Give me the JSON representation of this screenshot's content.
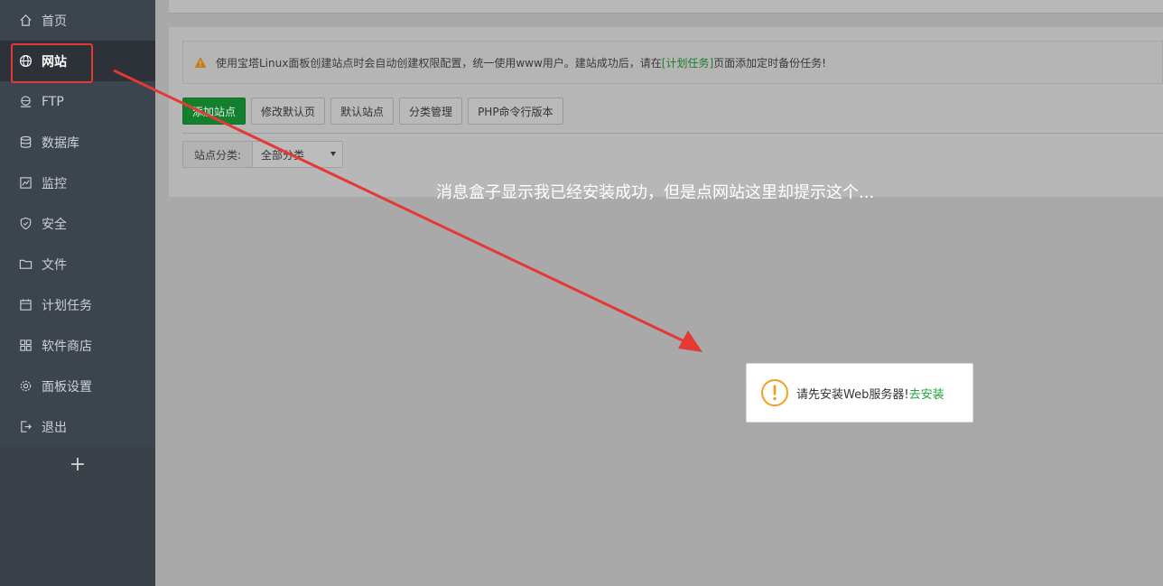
{
  "sidebar": {
    "items": [
      {
        "label": "首页",
        "icon": "home-icon"
      },
      {
        "label": "网站",
        "icon": "globe-icon",
        "active": true
      },
      {
        "label": "FTP",
        "icon": "ftp-icon"
      },
      {
        "label": "数据库",
        "icon": "database-icon"
      },
      {
        "label": "监控",
        "icon": "monitor-icon"
      },
      {
        "label": "安全",
        "icon": "shield-icon"
      },
      {
        "label": "文件",
        "icon": "folder-icon"
      },
      {
        "label": "计划任务",
        "icon": "calendar-icon"
      },
      {
        "label": "软件商店",
        "icon": "grid-icon"
      },
      {
        "label": "面板设置",
        "icon": "gear-icon"
      },
      {
        "label": "退出",
        "icon": "logout-icon"
      }
    ],
    "add_label": "+"
  },
  "notice": {
    "text_before": "使用宝塔Linux面板创建站点时会自动创建权限配置，统一使用www用户。建站成功后，请在",
    "link": "[计划任务]",
    "text_after": "页面添加定时备份任务!"
  },
  "toolbar": {
    "buttons": [
      "添加站点",
      "修改默认页",
      "默认站点",
      "分类管理",
      "PHP命令行版本"
    ]
  },
  "filter": {
    "label": "站点分类:",
    "selected": "全部分类"
  },
  "caption": "消息盒子显示我已经安装成功，但是点网站这里却提示这个...",
  "toast": {
    "message": "请先安装Web服务器!",
    "action": "去安装"
  },
  "colors": {
    "sidebar_bg": "#3c444d",
    "primary_green": "#20a53a",
    "annotation_red": "#e53935",
    "warning_orange": "#f0a020"
  }
}
